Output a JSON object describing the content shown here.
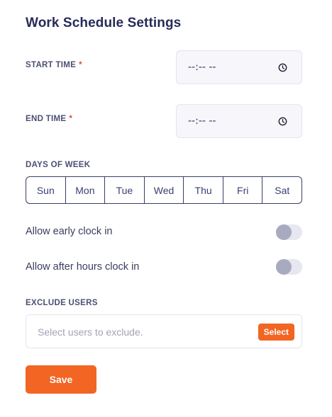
{
  "title": "Work Schedule Settings",
  "start_time": {
    "label": "START TIME",
    "required_mark": "*",
    "value": "--:-- --",
    "icon": "clock-icon"
  },
  "end_time": {
    "label": "END TIME",
    "required_mark": "*",
    "value": "--:-- --",
    "icon": "clock-icon"
  },
  "days_of_week": {
    "label": "DAYS OF WEEK",
    "days": [
      "Sun",
      "Mon",
      "Tue",
      "Wed",
      "Thu",
      "Fri",
      "Sat"
    ]
  },
  "toggles": {
    "early_clock_in": {
      "label": "Allow early clock in",
      "on": false
    },
    "after_hours_clock_in": {
      "label": "Allow after hours clock in",
      "on": false
    }
  },
  "exclude_users": {
    "label": "EXCLUDE USERS",
    "placeholder": "Select users to exclude.",
    "select_label": "Select"
  },
  "save_label": "Save",
  "colors": {
    "accent": "#f26522",
    "heading": "#262b58",
    "border": "#3a3e66",
    "toggle_off_knob": "#a8aabf"
  }
}
